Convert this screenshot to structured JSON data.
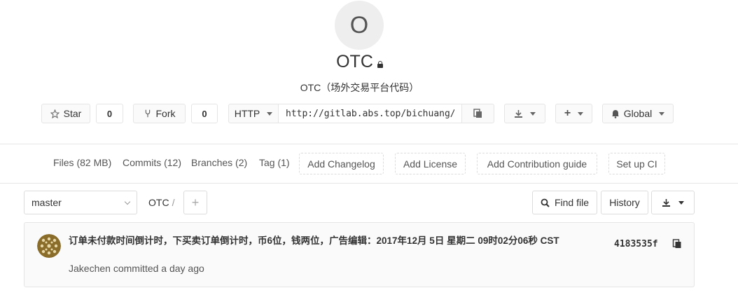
{
  "project": {
    "avatar_letter": "O",
    "name": "OTC",
    "description": "OTC（场外交易平台代码）"
  },
  "actions": {
    "star_label": "Star",
    "star_count": "0",
    "fork_label": "Fork",
    "fork_count": "0",
    "protocol": "HTTP",
    "clone_url": "http://gitlab.abs.top/bichuang/OTC.git",
    "notification_level": "Global"
  },
  "nav": {
    "files": "Files (82 MB)",
    "commits": "Commits (12)",
    "branches": "Branches (2)",
    "tags": "Tag (1)",
    "add_changelog": "Add Changelog",
    "add_license": "Add License",
    "add_contribution": "Add Contribution guide",
    "setup_ci": "Set up CI"
  },
  "tree": {
    "branch": "master",
    "breadcrumb": "OTC",
    "breadcrumb_sep": "/",
    "find_file": "Find file",
    "history": "History"
  },
  "commit": {
    "title": "订单未付款时间倒计时，下买卖订单倒计时，币6位，钱两位，广告编辑：2017年12月 5日 星期二 09时02分06秒 CST",
    "author": "Jakechen",
    "meta": "committed a day ago",
    "sha": "4183535f"
  },
  "colors": {
    "border": "#e5e5e5",
    "avatar_bg": "#eeeeee",
    "commit_bg": "#fafafa"
  }
}
